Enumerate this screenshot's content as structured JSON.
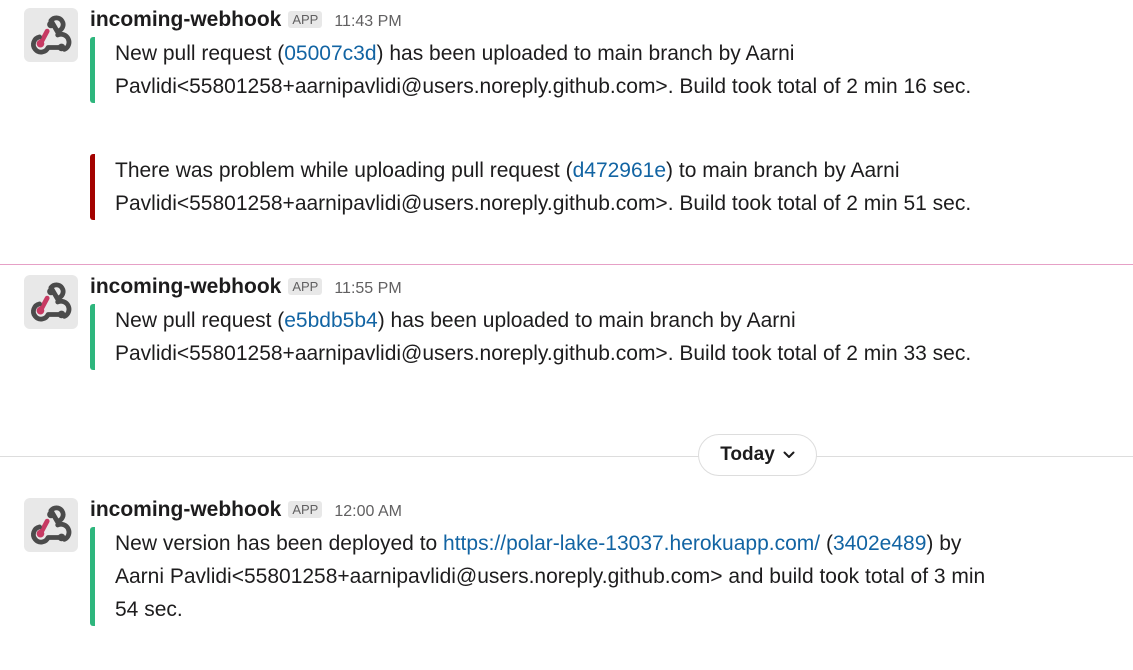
{
  "messages": [
    {
      "sender": "incoming-webhook",
      "badge": "APP",
      "time": "11:43 PM",
      "attachments": [
        {
          "color": "#2eb67d",
          "before": "New pull request (",
          "link": "05007c3d",
          "after": ") has been uploaded to main branch by Aarni Pavlidi<55801258+aarnipavlidi@users.noreply.github.com>. Build took total of 2 min 16 sec."
        },
        {
          "color": "#a30200",
          "before": "There was problem while uploading pull request (",
          "link": "d472961e",
          "after": ") to main branch by Aarni Pavlidi<55801258+aarnipavlidi@users.noreply.github.com>. Build took total of 2 min 51 sec."
        }
      ]
    },
    {
      "sender": "incoming-webhook",
      "badge": "APP",
      "time": "11:55 PM",
      "attachments": [
        {
          "color": "#2eb67d",
          "before": "New pull request (",
          "link": "e5bdb5b4",
          "after": ") has been uploaded to main branch by Aarni Pavlidi<55801258+aarnipavlidi@users.noreply.github.com>. Build took total of 2 min 33 sec."
        }
      ]
    },
    {
      "sender": "incoming-webhook",
      "badge": "APP",
      "time": "12:00 AM",
      "attachments": [
        {
          "color": "#2eb67d",
          "before": "New version has been deployed to ",
          "url": "https://polar-lake-13037.herokuapp.com/",
          "mid": " (",
          "link": "3402e489",
          "after": ") by Aarni Pavlidi<55801258+aarnipavlidi@users.noreply.github.com> and build took total of 3 min 54 sec."
        }
      ]
    }
  ],
  "day_divider": {
    "label": "Today",
    "icon": "chevron-down-icon"
  },
  "avatar_icon": "webhook-icon"
}
